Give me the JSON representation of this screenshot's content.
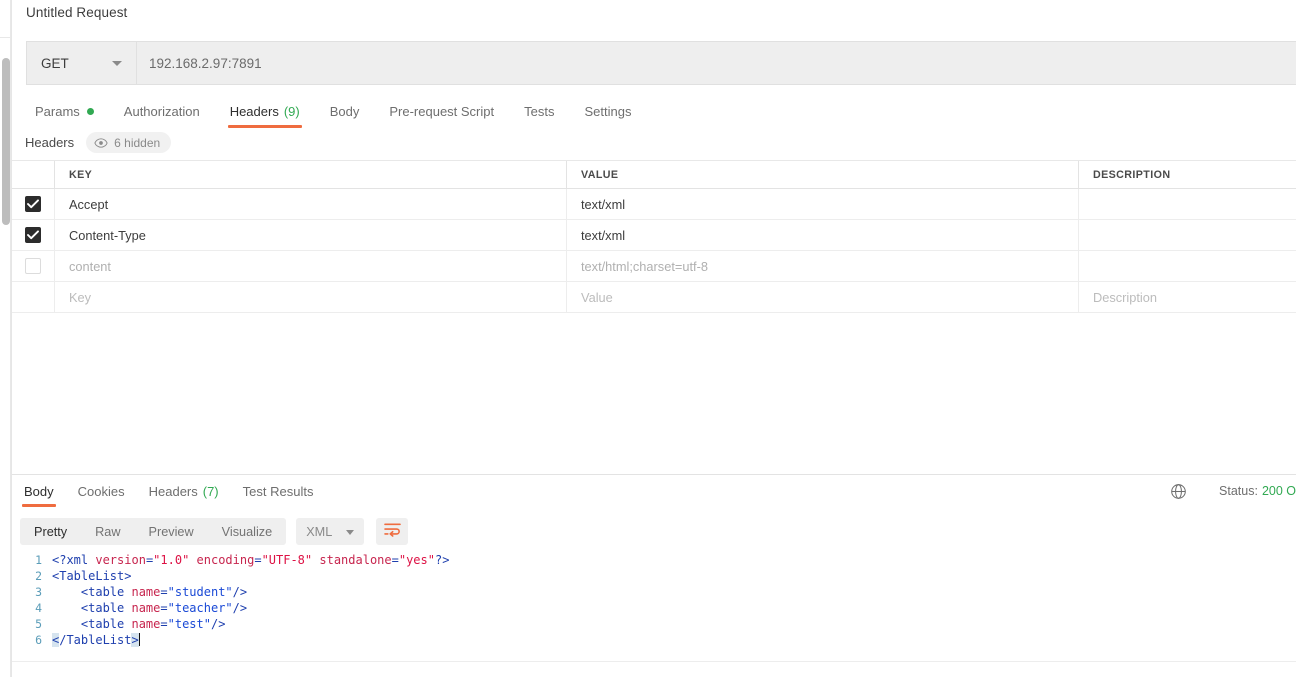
{
  "request": {
    "title": "Untitled Request",
    "method": "GET",
    "url": "192.168.2.97:7891",
    "tabs": [
      {
        "label": "Params",
        "dot": true,
        "active": false
      },
      {
        "label": "Authorization",
        "active": false
      },
      {
        "label": "Headers",
        "count": "(9)",
        "active": true
      },
      {
        "label": "Body",
        "active": false
      },
      {
        "label": "Pre-request Script",
        "active": false
      },
      {
        "label": "Tests",
        "active": false
      },
      {
        "label": "Settings",
        "active": false
      }
    ]
  },
  "headers_section": {
    "title": "Headers",
    "hidden_badge": "6 hidden",
    "hidden_icon": "eye-icon",
    "columns": [
      "KEY",
      "VALUE",
      "DESCRIPTION"
    ],
    "rows": [
      {
        "checked": true,
        "key": "Accept",
        "value": "text/xml",
        "description": "",
        "muted": false
      },
      {
        "checked": true,
        "key": "Content-Type",
        "value": "text/xml",
        "description": "",
        "muted": false
      },
      {
        "checked": false,
        "key": "content",
        "value": "text/html;charset=utf-8",
        "description": "",
        "muted": true
      },
      {
        "checked": null,
        "key": "Key",
        "value": "Value",
        "description": "Description",
        "placeholder": true
      }
    ]
  },
  "response": {
    "tabs": [
      {
        "label": "Body",
        "active": true
      },
      {
        "label": "Cookies",
        "active": false
      },
      {
        "label": "Headers",
        "count": "(7)",
        "active": false
      },
      {
        "label": "Test Results",
        "active": false
      }
    ],
    "status_icon": "globe-icon",
    "status_label": "Status:",
    "status_value": "200 O",
    "view_modes": [
      {
        "label": "Pretty",
        "active": true
      },
      {
        "label": "Raw",
        "active": false
      },
      {
        "label": "Preview",
        "active": false
      },
      {
        "label": "Visualize",
        "active": false
      }
    ],
    "language": "XML",
    "wrap_icon": "wrap-text-icon",
    "code": {
      "lines": [
        {
          "n": "1",
          "tokens": [
            {
              "t": "<?xml ",
              "c": "tok-pi"
            },
            {
              "t": "version",
              "c": "tok-attr"
            },
            {
              "t": "=",
              "c": "tok-punct"
            },
            {
              "t": "\"1.0\"",
              "c": "tok-pi-val"
            },
            {
              "t": " ",
              "c": "tok-punct"
            },
            {
              "t": "encoding",
              "c": "tok-attr"
            },
            {
              "t": "=",
              "c": "tok-punct"
            },
            {
              "t": "\"UTF-8\"",
              "c": "tok-pi-val"
            },
            {
              "t": " ",
              "c": "tok-punct"
            },
            {
              "t": "standalone",
              "c": "tok-attr"
            },
            {
              "t": "=",
              "c": "tok-punct"
            },
            {
              "t": "\"yes\"",
              "c": "tok-pi-val"
            },
            {
              "t": "?>",
              "c": "tok-pi"
            }
          ]
        },
        {
          "n": "2",
          "tokens": [
            {
              "t": "<TableList>",
              "c": "tok-tag"
            }
          ]
        },
        {
          "n": "3",
          "tokens": [
            {
              "t": "    <table ",
              "c": "tok-tag"
            },
            {
              "t": "name",
              "c": "tok-attr"
            },
            {
              "t": "=",
              "c": "tok-punct"
            },
            {
              "t": "\"student\"",
              "c": "tok-val"
            },
            {
              "t": "/>",
              "c": "tok-tag"
            }
          ]
        },
        {
          "n": "4",
          "tokens": [
            {
              "t": "    <table ",
              "c": "tok-tag"
            },
            {
              "t": "name",
              "c": "tok-attr"
            },
            {
              "t": "=",
              "c": "tok-punct"
            },
            {
              "t": "\"teacher\"",
              "c": "tok-val"
            },
            {
              "t": "/>",
              "c": "tok-tag"
            }
          ]
        },
        {
          "n": "5",
          "tokens": [
            {
              "t": "    <table ",
              "c": "tok-tag"
            },
            {
              "t": "name",
              "c": "tok-attr"
            },
            {
              "t": "=",
              "c": "tok-punct"
            },
            {
              "t": "\"test\"",
              "c": "tok-val"
            },
            {
              "t": "/>",
              "c": "tok-tag"
            }
          ]
        },
        {
          "n": "6",
          "tokens": [
            {
              "t": "<",
              "c": "tok-tag bracket-hl"
            },
            {
              "t": "/TableList",
              "c": "tok-tag"
            },
            {
              "t": ">",
              "c": "tok-tag bracket-hl"
            }
          ],
          "caret": true
        }
      ]
    }
  },
  "colors": {
    "accent": "#ef6c3f",
    "success": "#31a952",
    "text": "#3d3d3d",
    "muted": "#b0b0b0",
    "chrome": "#eeeeee"
  }
}
